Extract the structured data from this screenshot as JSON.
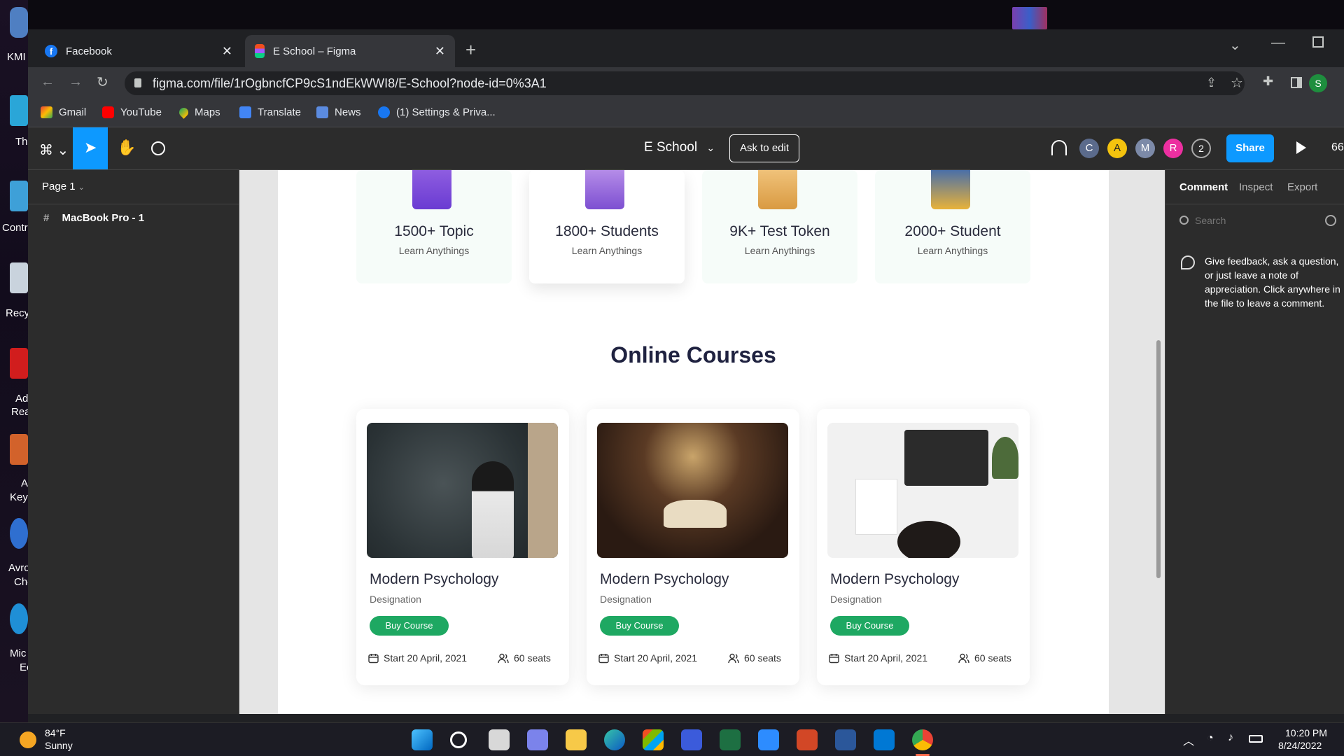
{
  "desktop": {
    "labels": [
      "KMI",
      "Thi",
      "Contr",
      "Recy",
      "Ad",
      "Rea",
      "A",
      "Keyl",
      "Avro",
      "Che",
      "Mic",
      "Ec"
    ]
  },
  "browser": {
    "tabs": [
      {
        "title": "Facebook",
        "close": "✕"
      },
      {
        "title": "E School – Figma",
        "close": "✕"
      }
    ],
    "new_tab": "+",
    "url": "figma.com/file/1rOgbncfCP9cS1ndEkWWI8/E-School?node-id=0%3A1",
    "profile_initial": "S",
    "bookmarks": [
      "Gmail",
      "YouTube",
      "Maps",
      "Translate",
      "News",
      "(1) Settings & Priva..."
    ]
  },
  "figma": {
    "file_name": "E School",
    "ask_to_edit": "Ask to edit",
    "avatars": [
      {
        "letter": "C",
        "color": "#5b6b8c"
      },
      {
        "letter": "A",
        "color": "#f4c30e"
      },
      {
        "letter": "M",
        "color": "#7c8aa8"
      },
      {
        "letter": "R",
        "color": "#ec2fa0"
      }
    ],
    "extra_count": "2",
    "share": "Share",
    "zoom": "66",
    "page_label": "Page 1",
    "layer": "MacBook Pro - 1",
    "right_tabs": [
      "Comment",
      "Inspect",
      "Export"
    ],
    "search_placeholder": "Search",
    "feedback_text": "Give feedback, ask a question, or just leave a note of appreciation. Click anywhere in the file to leave a comment."
  },
  "design": {
    "stats": [
      {
        "number": "1500+ Topic",
        "sub": "Learn Anythings"
      },
      {
        "number": "1800+ Students",
        "sub": "Learn Anythings"
      },
      {
        "number": "9K+ Test Token",
        "sub": "Learn Anythings"
      },
      {
        "number": "2000+ Student",
        "sub": "Learn Anythings"
      }
    ],
    "section_title": "Online Courses",
    "courses": [
      {
        "title": "Modern Psychology",
        "designation": "Designation",
        "button": "Buy Course",
        "start": "Start 20  April, 2021",
        "seats": "60 seats"
      },
      {
        "title": "Modern Psychology",
        "designation": "Designation",
        "button": "Buy Course",
        "start": "Start 20  April, 2021",
        "seats": "60 seats"
      },
      {
        "title": "Modern Psychology",
        "designation": "Designation",
        "button": "Buy Course",
        "start": "Start 20  April, 2021",
        "seats": "60 seats"
      }
    ],
    "colors": {
      "accent_green": "#1ea862",
      "heading": "#1f2240",
      "share_blue": "#0d99ff"
    }
  },
  "taskbar": {
    "temp": "84°F",
    "weather": "Sunny",
    "time": "10:20 PM",
    "date": "8/24/2022"
  }
}
